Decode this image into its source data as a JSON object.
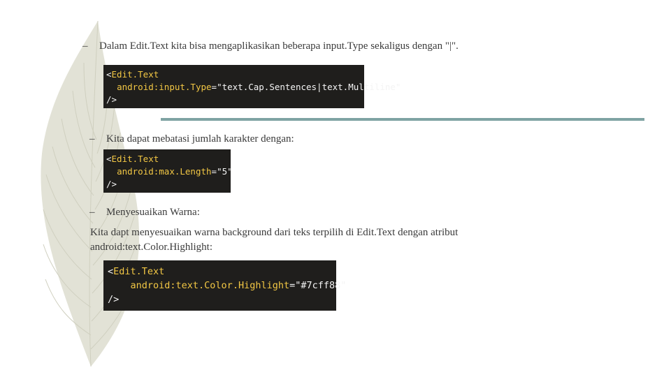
{
  "bullets": [
    {
      "dash": "–",
      "text": "Dalam Edit.Text kita bisa mengaplikasikan beberapa input.Type sekaligus dengan \"|\"."
    },
    {
      "dash": "–",
      "text": "Kita dapat mebatasi jumlah karakter dengan:"
    },
    {
      "dash": "–",
      "text": "Menyesuaikan Warna:"
    }
  ],
  "paragraph": {
    "line1": "Kita dapt menyesuaikan warna background dari teks terpilih di Edit.Text dengan atribut",
    "line2": "android:text.Color.Highlight:"
  },
  "code_blocks": [
    {
      "open": "<",
      "tag": "Edit.Text",
      "attr": "android:input.Type",
      "eq": "=",
      "value": "\"text.Cap.Sentences|text.Multiline\"",
      "close": "/>"
    },
    {
      "open": "<",
      "tag": "Edit.Text",
      "attr": "android:max.Length",
      "eq": "=",
      "value": "\"5\"",
      "close": "/>"
    },
    {
      "open": "<",
      "tag": "Edit.Text",
      "attr": "android:text.Color.Highlight",
      "eq": "=",
      "value": "\"#7cff88\"",
      "close": "/>"
    }
  ],
  "colors": {
    "code_background": "#1f1e1c",
    "code_keyword": "#f2c744",
    "code_text": "#f4f4f4",
    "rule_line": "#7fa3a3",
    "feather": "#d9d9cc"
  },
  "decorations": [
    "feather-illustration"
  ]
}
